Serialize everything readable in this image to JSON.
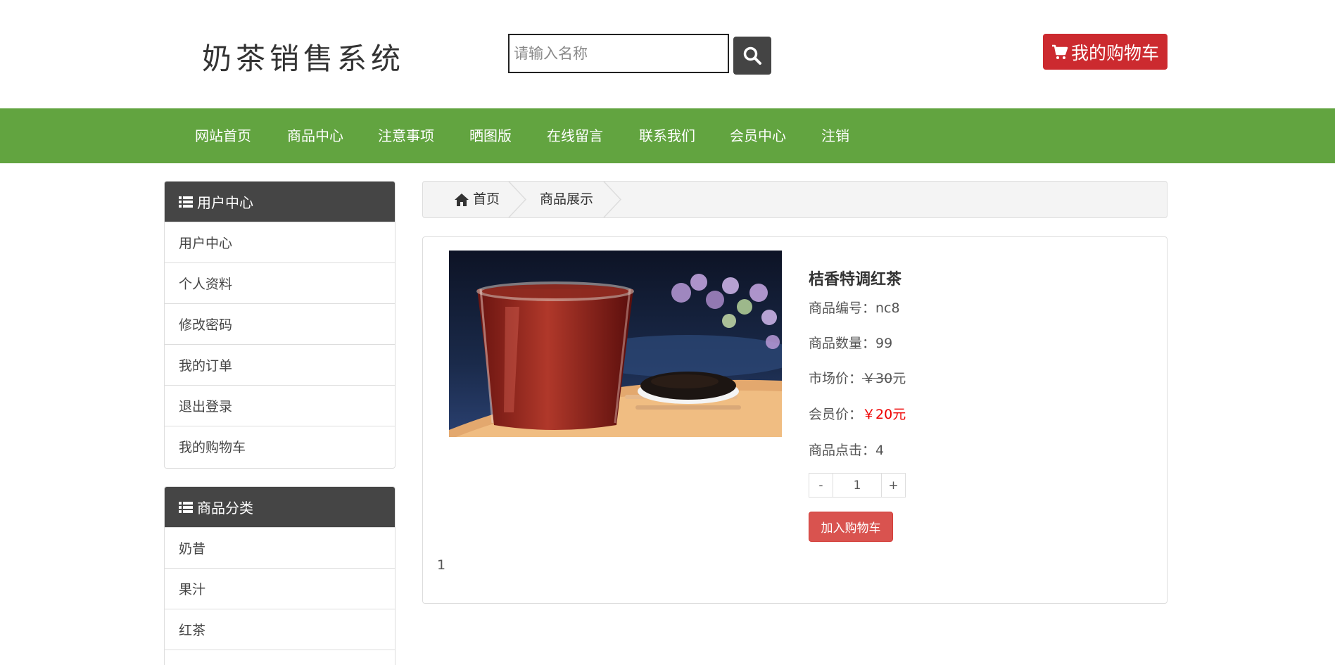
{
  "header": {
    "site_title": "奶茶销售系统",
    "search_placeholder": "请输入名称",
    "cart_label": "我的购物车"
  },
  "nav": {
    "items": [
      "网站首页",
      "商品中心",
      "注意事项",
      "晒图版",
      "在线留言",
      "联系我们",
      "会员中心",
      "注销"
    ]
  },
  "sidebar": {
    "user_center": {
      "title": "用户中心",
      "items": [
        "用户中心",
        "个人资料",
        "修改密码",
        "我的订单",
        "退出登录",
        "我的购物车"
      ]
    },
    "categories": {
      "title": "商品分类",
      "items": [
        "奶昔",
        "果汁",
        "红茶"
      ]
    }
  },
  "breadcrumb": {
    "home": "首页",
    "current": "商品展示"
  },
  "product": {
    "name": "桔香特调红茶",
    "code_label": "商品编号：",
    "code": "nc8",
    "stock_label": "商品数量：",
    "stock": "99",
    "market_price_label": "市场价：",
    "market_price": "￥30",
    "market_price_unit": "元",
    "member_price_label": "会员价：",
    "member_price": "￥20元",
    "clicks_label": "商品点击：",
    "clicks": "4",
    "qty_minus": "-",
    "qty_value": "1",
    "qty_plus": "+",
    "add_to_cart": "加入购物车",
    "page_number": "1"
  },
  "colors": {
    "nav_green": "#62a440",
    "cart_red": "#cc2a2f",
    "panel_dark": "#454545",
    "button_red": "#d9534f",
    "price_red": "#ee0000"
  }
}
